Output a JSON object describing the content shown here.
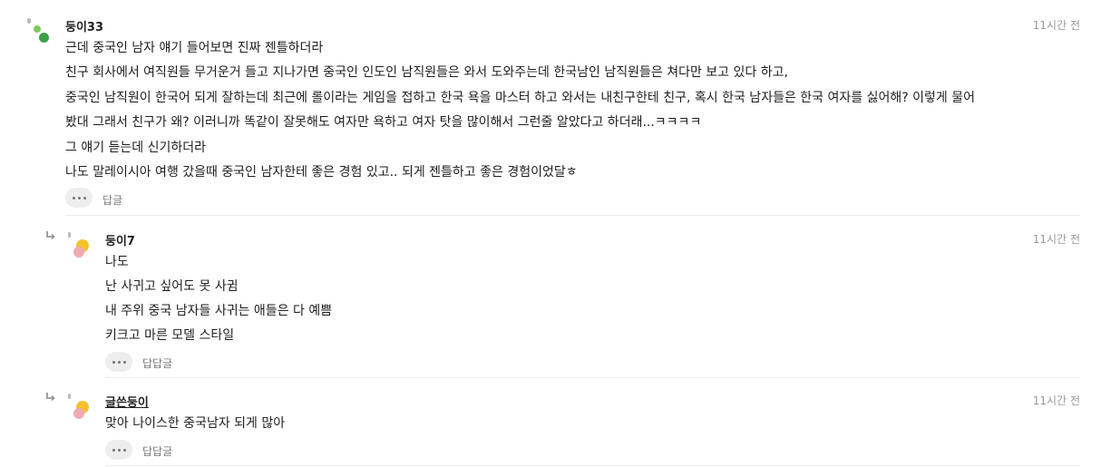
{
  "comments": [
    {
      "author": "둥이33",
      "time": "11시간 전",
      "lines": [
        "근데 중국인 남자 얘기 들어보면 진짜 젠틀하더라",
        "친구 회사에서 여직원들 무거운거 들고 지나가면 중국인 인도인 남직원들은 와서 도와주는데 한국남인 남직원들은 쳐다만 보고 있다 하고,",
        "중국인 남직원이 한국어 되게 잘하는데 최근에 롤이라는 게임을 접하고 한국 욕을 마스터 하고 와서는 내친구한테 친구, 혹시 한국 남자들은 한국 여자를 싫어해? 이렇게 물어",
        "봤대 그래서 친구가 왜? 이러니까 똑같이 잘못해도 여자만 욕하고 여자 탓을 많이해서 그런줄 알았다고 하더래...ㅋㅋㅋㅋ",
        "그 얘기 듣는데 신기하더라",
        "나도 말레이시아 여행 갔을때 중국인 남자한테 좋은 경험 있고.. 되게 젠틀하고 좋은 경험이었달ㅎ"
      ],
      "reply_label": "답글"
    },
    {
      "author": "둥이7",
      "time": "11시간 전",
      "lines": [
        "나도",
        "난 사귀고 싶어도 못 사귐",
        "내 주위 중국 남자들 사귀는 애들은 다 예쁨",
        "키크고 마른 모델 스타일"
      ],
      "reply_label": "답답글"
    },
    {
      "author": "글쓴둥이",
      "time": "11시간 전",
      "lines": [
        "맞아 나이스한 중국남자 되게 많아"
      ],
      "reply_label": "답답글"
    }
  ],
  "colors": {
    "avatar_green_dark": "#3aa04a",
    "avatar_green_light": "#7ccb5a",
    "avatar_yellow": "#f6c12e",
    "avatar_pink": "#f2a9b6"
  }
}
